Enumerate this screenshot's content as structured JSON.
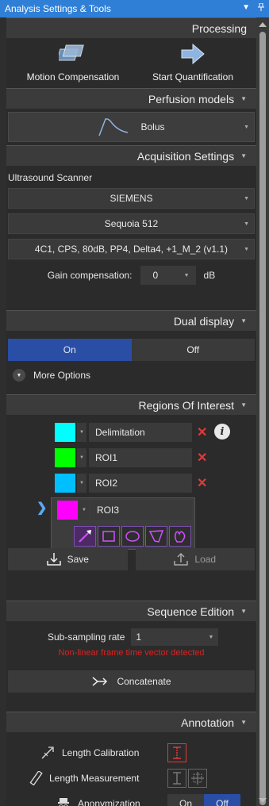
{
  "window": {
    "title": "Analysis Settings & Tools",
    "pin_icon": "pin-icon",
    "menu_icon": "dropdown-icon"
  },
  "processing": {
    "header": "Processing",
    "motion_compensation": "Motion Compensation",
    "start_quantification": "Start Quantification"
  },
  "perfusion": {
    "header": "Perfusion models",
    "model": "Bolus"
  },
  "acquisition": {
    "header": "Acquisition Settings",
    "scanner_label": "Ultrasound Scanner",
    "manufacturer": "SIEMENS",
    "model": "Sequoia 512",
    "preset": "4C1, CPS, 80dB, PP4, Delta4, +1_M_2 (v1.1)",
    "gain_label": "Gain compensation:",
    "gain_value": "0",
    "gain_unit": "dB"
  },
  "dual_display": {
    "header": "Dual display",
    "on": "On",
    "off": "Off",
    "selected": "On",
    "more_options": "More Options"
  },
  "roi": {
    "header": "Regions Of Interest",
    "items": [
      {
        "name": "Delimitation",
        "color": "#00ffff"
      },
      {
        "name": "ROI1",
        "color": "#00ff00"
      },
      {
        "name": "ROI2",
        "color": "#00bfff"
      },
      {
        "name": "ROI3",
        "color": "#ff00ff"
      }
    ],
    "active_index": 3,
    "save": "Save",
    "load": "Load",
    "tool_color": "#c040ff"
  },
  "sequence": {
    "header": "Sequence Edition",
    "sub_sampling_label": "Sub-sampling rate",
    "sub_sampling_value": "1",
    "warning": "Non-linear frame time vector detected",
    "concatenate": "Concatenate"
  },
  "annotation": {
    "header": "Annotation",
    "length_calibration": "Length Calibration",
    "length_measurement": "Length Measurement",
    "anonymization": "Anonymization",
    "anon_on": "On",
    "anon_off": "Off",
    "anon_selected": "Off"
  }
}
